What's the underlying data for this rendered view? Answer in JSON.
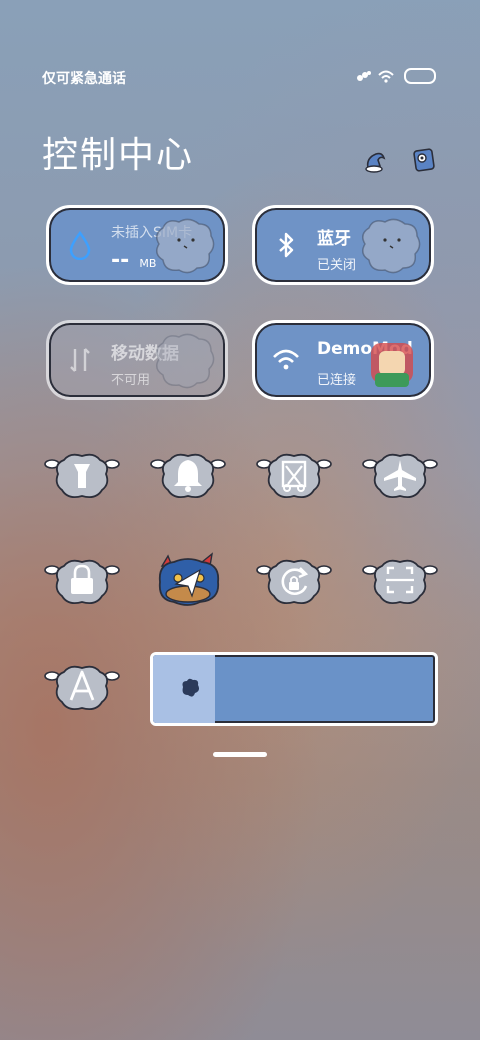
{
  "status": {
    "carrier_text": "仅可紧急通话"
  },
  "header": {
    "title": "控制中心"
  },
  "cards": {
    "data_usage": {
      "label": "未插入SIM卡",
      "value": "--",
      "unit": "MB"
    },
    "bluetooth": {
      "label": "蓝牙",
      "status": "已关闭"
    },
    "mobile_data": {
      "label": "移动数据",
      "status": "不可用"
    },
    "wifi": {
      "label": "DemoMod",
      "status": "已连接"
    }
  },
  "toggles": [
    {
      "icon": "flashlight-icon"
    },
    {
      "icon": "bell-icon"
    },
    {
      "icon": "screenshot-icon"
    },
    {
      "icon": "airplane-icon"
    },
    {
      "icon": "lock-icon"
    },
    {
      "icon": "location-icon"
    },
    {
      "icon": "rotation-lock-icon"
    },
    {
      "icon": "scan-icon"
    },
    {
      "icon": "auto-brightness-icon"
    }
  ],
  "brightness": {
    "level": 0.22
  },
  "colors": {
    "accent": "#6f93c6",
    "accent_light": "#a9c0e4",
    "outline": "#2b2e3a"
  }
}
